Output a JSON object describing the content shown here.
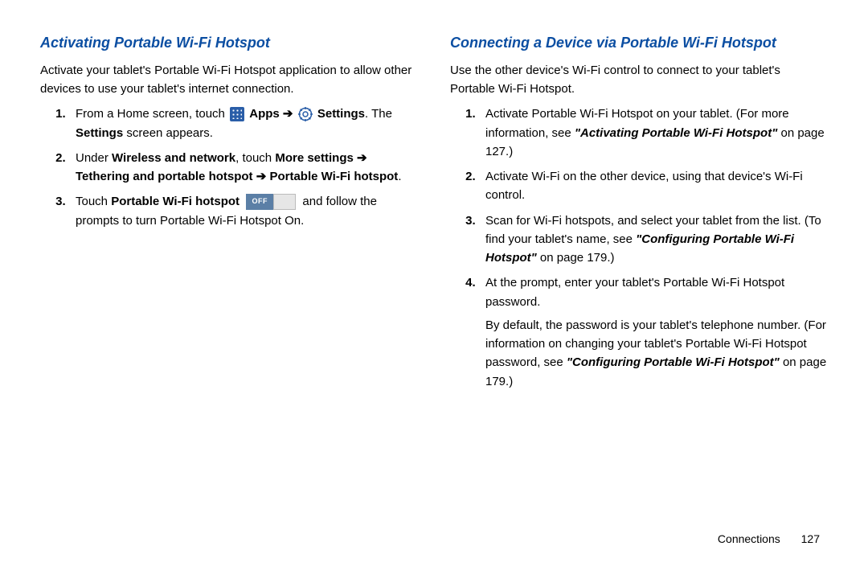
{
  "left": {
    "heading": "Activating Portable Wi-Fi Hotspot",
    "intro": "Activate your tablet's Portable Wi-Fi Hotspot application to allow other devices to use your tablet's internet connection.",
    "step1_a": "From a Home screen, touch ",
    "step1_apps": "Apps",
    "step1_arrow1": " ➔ ",
    "step1_settings": "Settings",
    "step1_b": ". The ",
    "step1_settings2": "Settings",
    "step1_c": " screen appears.",
    "step2_a": "Under ",
    "step2_wn": "Wireless and network",
    "step2_b": ", touch ",
    "step2_more": "More settings",
    "step2_arrow1": " ➔ ",
    "step2_teth": "Tethering and portable hotspot",
    "step2_arrow2": " ➔ ",
    "step2_pwh": "Portable Wi-Fi hotspot",
    "step2_c": ".",
    "step3_a": "Touch ",
    "step3_pwh": "Portable Wi-Fi hotspot",
    "step3_off": "OFF",
    "step3_b": " and follow the prompts to turn Portable Wi-Fi Hotspot On."
  },
  "right": {
    "heading": "Connecting a Device via Portable Wi-Fi Hotspot",
    "intro": "Use the other device's Wi-Fi control to connect to your tablet's Portable Wi-Fi Hotspot.",
    "step1_a": "Activate Portable Wi-Fi Hotspot on your tablet. (For more information, see ",
    "step1_ref": "\"Activating Portable Wi-Fi Hotspot\"",
    "step1_b": " on page 127.)",
    "step2": "Activate Wi-Fi on the other device, using that device's Wi-Fi control.",
    "step3_a": "Scan for Wi-Fi hotspots, and select your tablet from the list. (To find your tablet's name, see ",
    "step3_ref": "\"Configuring Portable Wi-Fi Hotspot\"",
    "step3_b": " on page 179.)",
    "step4_a": "At the prompt, enter your tablet's Portable Wi-Fi Hotspot password.",
    "step4_note_a": "By default, the password is your tablet's telephone number. (For information on changing your tablet's Portable Wi-Fi Hotspot password, see ",
    "step4_note_ref": "\"Configuring Portable Wi-Fi Hotspot\"",
    "step4_note_b": " on page 179.)"
  },
  "footer": {
    "section": "Connections",
    "page": "127"
  }
}
